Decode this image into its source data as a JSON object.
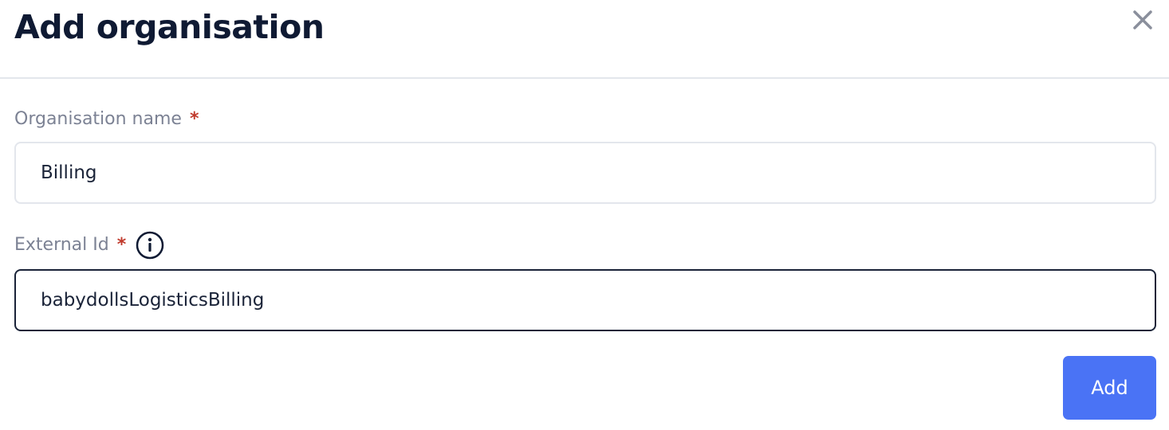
{
  "dialog": {
    "title": "Add organisation",
    "close_icon": "close-icon"
  },
  "fields": {
    "organisation_name": {
      "label": "Organisation name",
      "required_marker": "*",
      "value": "Billing"
    },
    "external_id": {
      "label": "External Id",
      "required_marker": "*",
      "info_icon": "info-icon",
      "value": "babydollsLogisticsBilling"
    }
  },
  "actions": {
    "add_label": "Add"
  },
  "colors": {
    "primary": "#4a73f5",
    "required": "#c0392b",
    "title": "#0f1a33",
    "label": "#7c8294",
    "border": "#e3e6ec",
    "focused_border": "#1a2338"
  }
}
